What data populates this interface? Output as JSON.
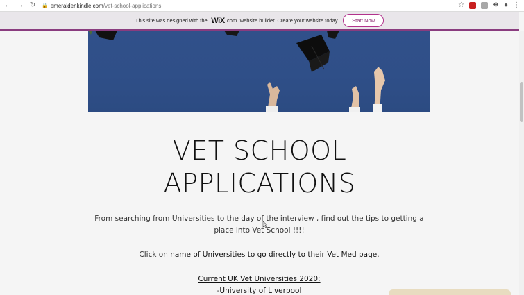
{
  "browser": {
    "url_host": "emeraldenkindle.com",
    "url_path": "/vet-school-applications"
  },
  "wix_banner": {
    "text_before": "This site was designed with the",
    "logo": "WiX",
    "logo_suffix": ".com",
    "text_after": "website builder. Create your website today.",
    "button_label": "Start Now",
    "accent_color": "#8a3c7f"
  },
  "page": {
    "title_line1": "VET SCHOOL",
    "title_line2": "APPLICATIONS",
    "intro": "From searching from Universities to the day of the interview , find out the tips to getting a place into Vet School !!!!",
    "click_prefix": "Click on",
    "click_link": "name of Universities to go directly to their Vet Med page.",
    "list_heading": "Current UK Vet Universities 2020:",
    "list_item_prefix": "-",
    "list_item_1": "University of Liverpool"
  }
}
